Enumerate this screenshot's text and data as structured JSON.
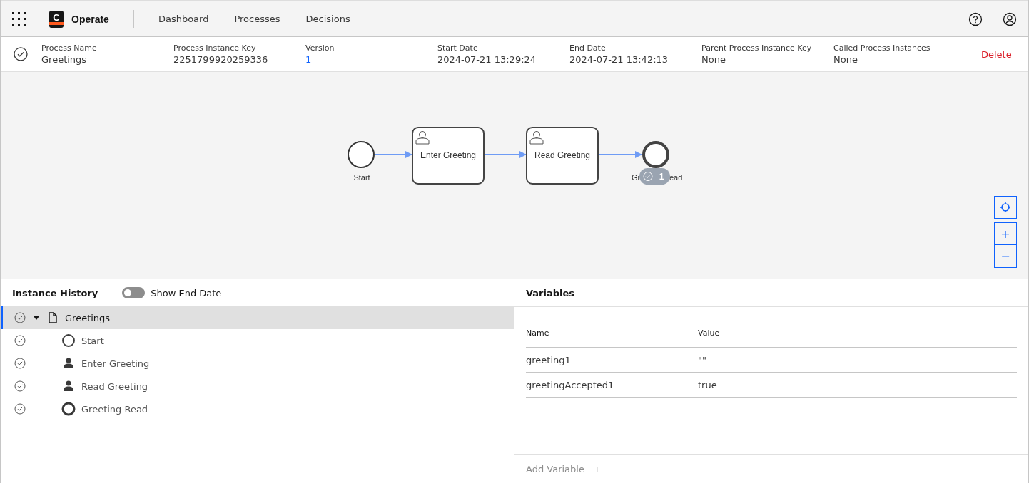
{
  "header": {
    "app_name": "Operate",
    "logo_letter": "C",
    "nav": [
      {
        "label": "Dashboard",
        "selected": false
      },
      {
        "label": "Processes",
        "selected": false
      },
      {
        "label": "Decisions",
        "selected": false
      }
    ]
  },
  "instance": {
    "fields": [
      {
        "label": "Process Name",
        "value": "Greetings",
        "kind": "text"
      },
      {
        "label": "Process Instance Key",
        "value": "2251799920259336",
        "kind": "text"
      },
      {
        "label": "Version",
        "value": "1",
        "kind": "link"
      },
      {
        "label": "Start Date",
        "value": "2024-07-21 13:29:24",
        "kind": "text"
      },
      {
        "label": "End Date",
        "value": "2024-07-21 13:42:13",
        "kind": "text"
      },
      {
        "label": "Parent Process Instance Key",
        "value": "None",
        "kind": "text"
      },
      {
        "label": "Called Process Instances",
        "value": "None",
        "kind": "text"
      }
    ],
    "delete_label": "Delete"
  },
  "diagram": {
    "start": {
      "label": "Start"
    },
    "tasks": [
      {
        "label": "Enter Greeting"
      },
      {
        "label": "Read Greeting"
      }
    ],
    "end": {
      "label_start": "Gr",
      "label_end": "ead"
    },
    "badge": {
      "count": "1"
    },
    "zoom_in": "+",
    "zoom_out": "−"
  },
  "history": {
    "title": "Instance History",
    "toggle": {
      "label": "Show End Date",
      "on": false
    },
    "tree": [
      {
        "label": "Greetings",
        "kind": "process",
        "selected": true,
        "expanded": true,
        "children": [
          {
            "label": "Start",
            "kind": "start-event",
            "selected": false
          },
          {
            "label": "Enter Greeting",
            "kind": "user-task",
            "selected": false
          },
          {
            "label": "Read Greeting",
            "kind": "user-task",
            "selected": false
          },
          {
            "label": "Greeting Read",
            "kind": "end-event",
            "selected": false
          }
        ]
      }
    ]
  },
  "variables": {
    "title": "Variables",
    "columns": [
      "Name",
      "Value"
    ],
    "rows": [
      {
        "name": "greeting1",
        "value": "\"\""
      },
      {
        "name": "greetingAccepted1",
        "value": "true"
      }
    ],
    "add_label": "Add Variable",
    "add_icon": "+"
  }
}
